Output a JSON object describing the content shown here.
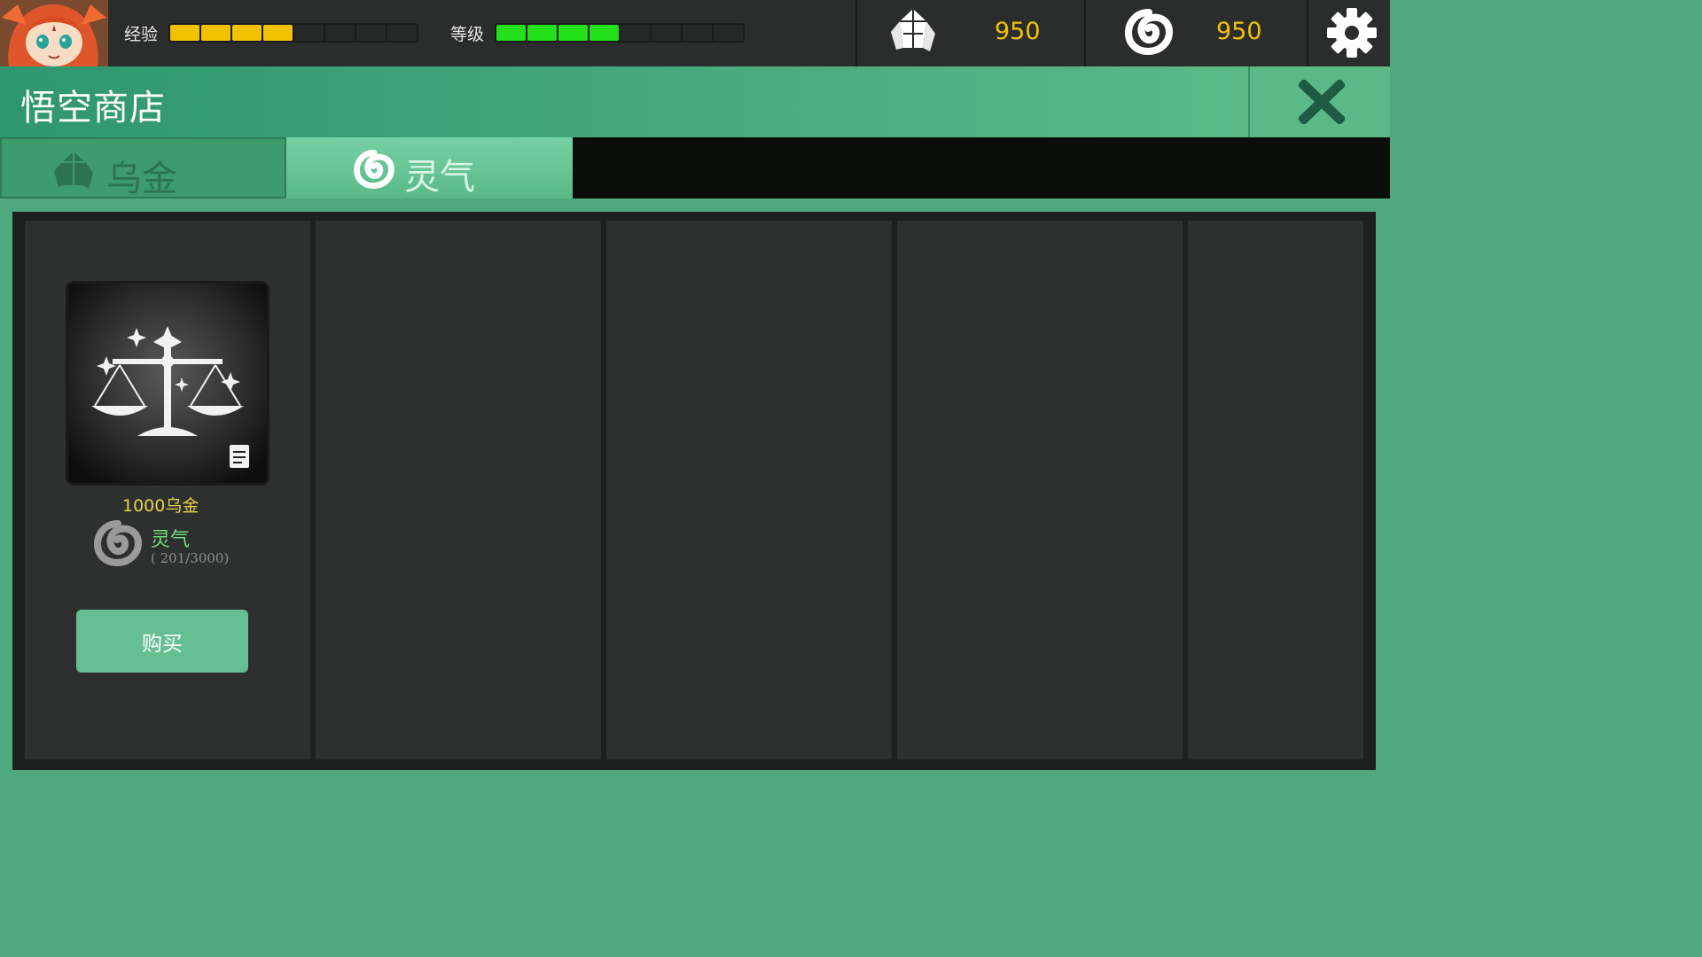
{
  "topbar": {
    "exp_label": "经验",
    "exp_progress": 0.5,
    "level_label": "等级",
    "level_progress": 0.5,
    "gold_value": "950",
    "aura_value": "950",
    "bar_fill_exp": "#f2c200",
    "bar_fill_level": "#22e01a"
  },
  "title": "悟空商店",
  "tabs": [
    {
      "label": "乌金",
      "icon": "crystal-icon",
      "active": false
    },
    {
      "label": "灵气",
      "icon": "swirl-icon",
      "active": true
    }
  ],
  "items": [
    {
      "name": "1000乌金",
      "icon": "scales-icon",
      "currency_label": "灵气",
      "currency_count": "( 201/3000)",
      "buy_label": "购买"
    }
  ],
  "colors": {
    "accent": "#50a97e",
    "gold_text": "#f2c200",
    "aura_text": "#6fe07a",
    "panel": "#2e302f"
  }
}
